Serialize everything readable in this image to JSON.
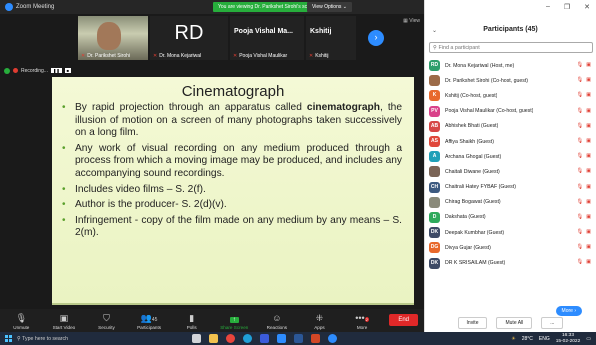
{
  "window": {
    "title": "Zoom Meeting"
  },
  "banner": {
    "viewing": "You are viewing Dr. Parikshet Sirohi's screen",
    "view_options": "View Options ⌄"
  },
  "videos": [
    {
      "name": "Dr. Parikshet Sirohi"
    },
    {
      "initials": "RD",
      "name": "Dr. Mona Kejariwal"
    },
    {
      "title": "Pooja Vishal Ma...",
      "name": "Pooja Vishal Maulikar"
    },
    {
      "title": "Kshitij",
      "name": "Kshitij"
    }
  ],
  "view_label": "View",
  "recording": {
    "label": "Recording...",
    "pause": "❚❚",
    "stop": "■"
  },
  "slide": {
    "title": "Cinematograph",
    "bullets": [
      {
        "before": "By rapid projection through an apparatus called ",
        "bold": "cinematograph",
        "after": ", the illusion of motion on a screen of many photographs taken successively on a long film."
      },
      {
        "before": "Any work of visual recording on any medium produced through a process from which a moving image may be produced, and includes any accompanying sound recordings.",
        "bold": "",
        "after": ""
      },
      {
        "before": "Includes video films – S. 2(f).",
        "bold": "",
        "after": ""
      },
      {
        "before": "Author is the producer- S. 2(d)(v).",
        "bold": "",
        "after": ""
      },
      {
        "before": "Infringement - copy of the film made on any medium by any means – S. 2(m).",
        "bold": "",
        "after": ""
      }
    ]
  },
  "toolbar": {
    "unmute": "Unmute",
    "start_video": "Start Video",
    "security": "Security",
    "participants": "Participants",
    "participants_count": "45",
    "polls": "Polls",
    "share_screen": "Share Screen",
    "reactions": "Reactions",
    "apps": "Apps",
    "more": "More",
    "more_badge": "2",
    "end": "End"
  },
  "panel": {
    "title": "Participants (45)",
    "search_placeholder": "Find a participant",
    "participants": [
      {
        "initials": "RD",
        "color": "#2e9e6b",
        "name": "Dr. Mona Kejariwal (Host, me)"
      },
      {
        "initials": "",
        "color": "#9c6b48",
        "name": "Dr. Parikshet Sirohi (Co-host, guest)"
      },
      {
        "initials": "K",
        "color": "#e8692c",
        "name": "Kshitij (Co-host, guest)"
      },
      {
        "initials": "PV",
        "color": "#d9418a",
        "name": "Pooja Vishal Maulikar (Co-host, guest)"
      },
      {
        "initials": "AB",
        "color": "#d64545",
        "name": "Abhishek Bhati (Guest)"
      },
      {
        "initials": "AS",
        "color": "#e0473a",
        "name": "Affiya Shaikh (Guest)"
      },
      {
        "initials": "A",
        "color": "#1fa0b8",
        "name": "Archana Ghogal (Guest)"
      },
      {
        "initials": "",
        "color": "#7a6456",
        "name": "Chaitali Diwane (Guest)"
      },
      {
        "initials": "CH",
        "color": "#3d5a80",
        "name": "Chaitrali Hatey FYBAF (Guest)"
      },
      {
        "initials": "",
        "color": "#8a8a7a",
        "name": "Chirag Bogawat (Guest)"
      },
      {
        "initials": "D",
        "color": "#2eaa5c",
        "name": "Dakshata (Guest)"
      },
      {
        "initials": "DK",
        "color": "#3d4a66",
        "name": "Deepak Kumbhar (Guest)"
      },
      {
        "initials": "DG",
        "color": "#e8692c",
        "name": "Divya Gujar (Guest)"
      },
      {
        "initials": "DK",
        "color": "#3d4a66",
        "name": "DR K SRISAILAM (Guest)"
      }
    ],
    "more_label": "More ›",
    "invite": "Invite",
    "mute_all": "Mute All",
    "more_dots": "..."
  },
  "taskbar": {
    "search": "Type here to search",
    "weather": "28°C",
    "lang": "ENG",
    "time": "16:33",
    "date": "15-02-2022"
  },
  "colors": {
    "accent": "#2d8cff",
    "end": "#e02828",
    "share": "#27ae3c",
    "slide_bg": "#eef5cc"
  }
}
